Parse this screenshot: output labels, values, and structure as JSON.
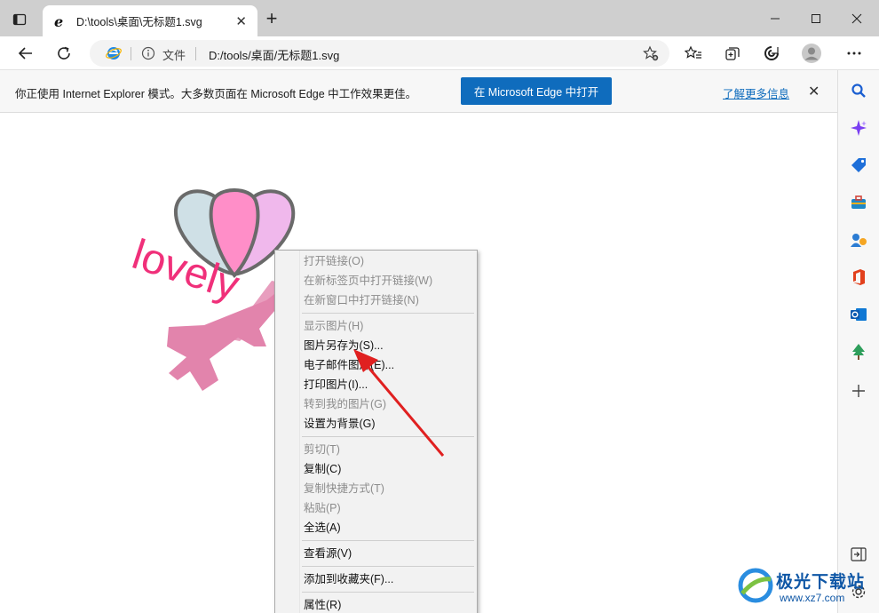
{
  "tab": {
    "title": "D:\\tools\\桌面\\无标题1.svg"
  },
  "address": {
    "site_label": "文件",
    "url": "D:/tools/桌面/无标题1.svg"
  },
  "ie_bar": {
    "message": "你正使用 Internet Explorer 模式。大多数页面在 Microsoft Edge 中工作效果更佳。",
    "open_button": "在 Microsoft Edge 中打开",
    "learn_more": "了解更多信息"
  },
  "artwork": {
    "text": "lovely"
  },
  "context_menu": {
    "groups": [
      [
        {
          "label": "打开链接(O)",
          "enabled": false
        },
        {
          "label": "在新标签页中打开链接(W)",
          "enabled": false
        },
        {
          "label": "在新窗口中打开链接(N)",
          "enabled": false
        }
      ],
      [
        {
          "label": "显示图片(H)",
          "enabled": false
        },
        {
          "label": "图片另存为(S)...",
          "enabled": true
        },
        {
          "label": "电子邮件图片(E)...",
          "enabled": true
        },
        {
          "label": "打印图片(I)...",
          "enabled": true
        },
        {
          "label": "转到我的图片(G)",
          "enabled": false
        },
        {
          "label": "设置为背景(G)",
          "enabled": true
        }
      ],
      [
        {
          "label": "剪切(T)",
          "enabled": false
        },
        {
          "label": "复制(C)",
          "enabled": true
        },
        {
          "label": "复制快捷方式(T)",
          "enabled": false
        },
        {
          "label": "粘贴(P)",
          "enabled": false
        },
        {
          "label": "全选(A)",
          "enabled": true
        }
      ],
      [
        {
          "label": "查看源(V)",
          "enabled": true
        }
      ],
      [
        {
          "label": "添加到收藏夹(F)...",
          "enabled": true
        }
      ],
      [
        {
          "label": "属性(R)",
          "enabled": true
        }
      ]
    ]
  },
  "watermark": {
    "name": "极光下载站",
    "url": "www.xz7.com"
  },
  "colors": {
    "accent": "#0f6cbd",
    "annotation_arrow": "#e02020",
    "art_pink": "#f0307a"
  }
}
